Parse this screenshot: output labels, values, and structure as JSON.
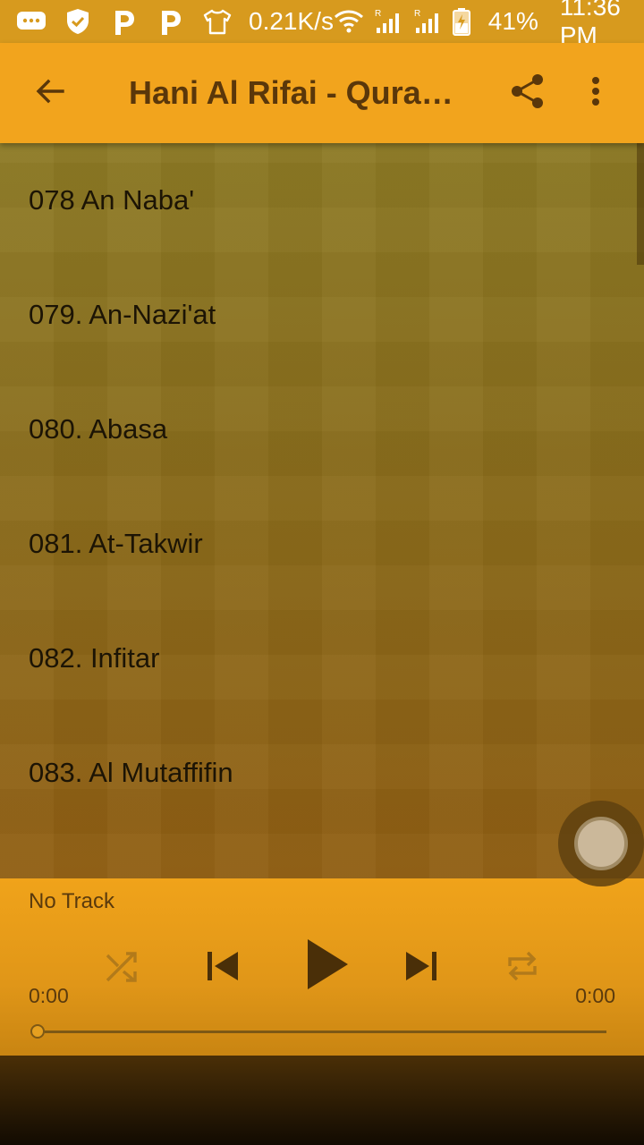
{
  "status_bar": {
    "speed": "0.21K/s",
    "battery_percent": "41%",
    "time": "11:36 PM",
    "icons": [
      "message-icon",
      "shield-icon",
      "parking-icon",
      "parking-icon",
      "shirt-icon",
      "wifi-icon",
      "signal-icon",
      "signal-icon",
      "battery-icon"
    ]
  },
  "app_bar": {
    "title": "Hani Al Rifai - Qura…",
    "icons": [
      "back-arrow-icon",
      "share-icon",
      "more-vert-icon"
    ]
  },
  "tracks": [
    "078 An Naba'",
    "079. An-Nazi'at",
    "080. Abasa",
    "081. At-Takwir",
    "082. Infitar",
    "083. Al Mutaffifin"
  ],
  "player": {
    "now_playing": "No Track",
    "time_elapsed": "0:00",
    "time_total": "0:00",
    "progress": 0,
    "icons": [
      "shuffle-icon",
      "skip-previous-icon",
      "play-icon",
      "skip-next-icon",
      "repeat-icon"
    ]
  },
  "colors": {
    "status_bar": "#d79a1e",
    "app_bar": "#f2a41d",
    "title_text": "#5a370a",
    "player": "#f0a31a"
  }
}
